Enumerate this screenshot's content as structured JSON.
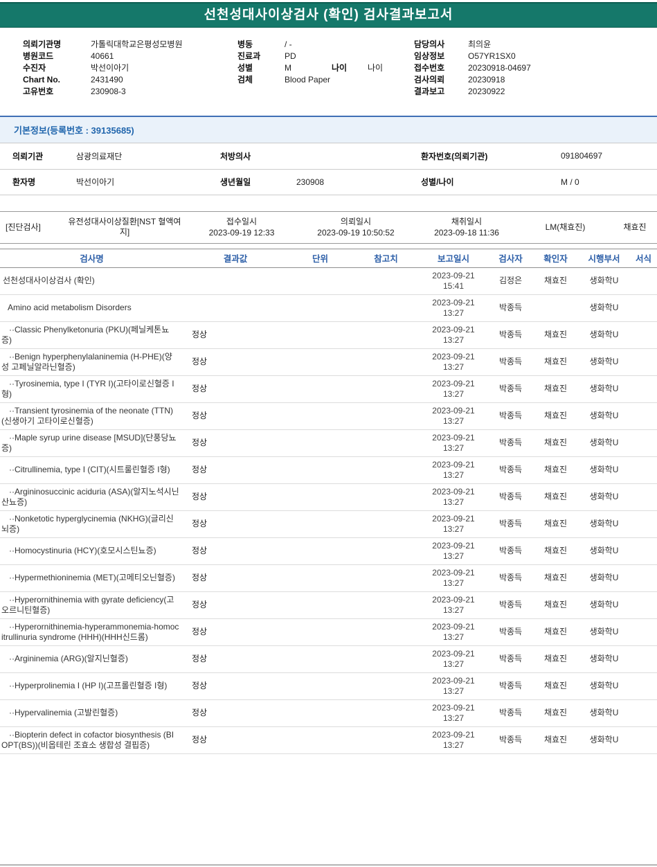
{
  "page": {
    "title": "선천성대사이상검사 (확인) 검사결과보고서"
  },
  "header": {
    "left": [
      {
        "label": "의뢰기관명",
        "value": "가톨릭대학교은평성모병원"
      },
      {
        "label": "병원코드",
        "value": "40661"
      },
      {
        "label": "수진자",
        "value": "박선이아기"
      },
      {
        "label": "Chart No.",
        "value": "2431490"
      },
      {
        "label": "고유번호",
        "value": "230908-3"
      }
    ],
    "middle": [
      {
        "label": "병동",
        "value": "/ -"
      },
      {
        "label": "진료과",
        "value": "PD"
      },
      {
        "label": "성별",
        "value": "M"
      },
      {
        "label": "검체",
        "value": "Blood Paper"
      }
    ],
    "age": {
      "label": "나이",
      "value": "나이"
    },
    "right": [
      {
        "label": "담당의사",
        "value": "최의윤"
      },
      {
        "label": "임상정보",
        "value": "O57YR1SX0"
      },
      {
        "label": "접수번호",
        "value": "20230918-04697"
      },
      {
        "label": "검사의뢰",
        "value": "20230918"
      },
      {
        "label": "결과보고",
        "value": "20230922"
      }
    ]
  },
  "basic_info": {
    "title": "기본정보(등록번호 : 39135685)",
    "rows": [
      {
        "cells": [
          {
            "label": "의뢰기관",
            "value": "삼광의료재단"
          },
          {
            "label": "처방의사",
            "value": ""
          },
          {
            "label": "환자번호(의뢰기관)",
            "value": "091804697"
          }
        ]
      },
      {
        "cells": [
          {
            "label": "환자명",
            "value": "박선이아기"
          },
          {
            "label": "생년월일",
            "value": "230908"
          },
          {
            "label": "성별/나이",
            "value": "M / 0"
          }
        ]
      }
    ]
  },
  "diagnosis": {
    "section_label": "[진단검사]",
    "test_name": "유전성대사이상질환[NST 혈액여지]",
    "receipt_label": "접수일시",
    "receipt_value": "2023-09-19 12:33",
    "request_label": "의뢰일시",
    "request_value": "2023-09-19 10:50:52",
    "collection_label": "채취일시",
    "collection_value": "2023-09-18 11:36",
    "collector": "LM(채효진)",
    "collector2": "채효진"
  },
  "results": {
    "columns": [
      "검사명",
      "결과값",
      "단위",
      "참고치",
      "보고일시",
      "검사자",
      "확인자",
      "시행부서",
      "서식"
    ],
    "rows": [
      {
        "indent": 0,
        "name": "선천성대사이상검사 (확인)",
        "result": "",
        "unit": "",
        "ref": "",
        "date": "2023-09-21",
        "time": "15:41",
        "tester": "김정은",
        "confirmer": "채효진",
        "dept": "생화학U",
        "format": ""
      },
      {
        "indent": 1,
        "name": "Amino acid metabolism Disorders",
        "result": "",
        "unit": "",
        "ref": "",
        "date": "2023-09-21",
        "time": "13:27",
        "tester": "박종득",
        "confirmer": "",
        "dept": "생화학U",
        "format": ""
      },
      {
        "indent": 2,
        "name": "··Classic Phenylketonuria (PKU)(페닐케톤뇨증)",
        "result": "정상",
        "unit": "",
        "ref": "",
        "date": "2023-09-21",
        "time": "13:27",
        "tester": "박종득",
        "confirmer": "채효진",
        "dept": "생화학U",
        "format": ""
      },
      {
        "indent": 2,
        "name": "··Benign hyperphenylalaninemia (H-PHE)(양성 고페닐알라닌혈증)",
        "result": "정상",
        "unit": "",
        "ref": "",
        "date": "2023-09-21",
        "time": "13:27",
        "tester": "박종득",
        "confirmer": "채효진",
        "dept": "생화학U",
        "format": ""
      },
      {
        "indent": 2,
        "name": "··Tyrosinemia, type I (TYR I)(고타이로신혈증 I형)",
        "result": "정상",
        "unit": "",
        "ref": "",
        "date": "2023-09-21",
        "time": "13:27",
        "tester": "박종득",
        "confirmer": "채효진",
        "dept": "생화학U",
        "format": ""
      },
      {
        "indent": 2,
        "name": "··Transient tyrosinemia of the neonate (TTN)(신생아기 고타이로신혈증)",
        "result": "정상",
        "unit": "",
        "ref": "",
        "date": "2023-09-21",
        "time": "13:27",
        "tester": "박종득",
        "confirmer": "채효진",
        "dept": "생화학U",
        "format": ""
      },
      {
        "indent": 2,
        "name": "··Maple syrup urine disease [MSUD](단풍당뇨증)",
        "result": "정상",
        "unit": "",
        "ref": "",
        "date": "2023-09-21",
        "time": "13:27",
        "tester": "박종득",
        "confirmer": "채효진",
        "dept": "생화학U",
        "format": ""
      },
      {
        "indent": 2,
        "name": "··Citrullinemia, type I (CIT)(시트룰린혈증 I형)",
        "result": "정상",
        "unit": "",
        "ref": "",
        "date": "2023-09-21",
        "time": "13:27",
        "tester": "박종득",
        "confirmer": "채효진",
        "dept": "생화학U",
        "format": ""
      },
      {
        "indent": 2,
        "name": "··Argininosuccinic aciduria (ASA)(알지노석시닌산뇨증)",
        "result": "정상",
        "unit": "",
        "ref": "",
        "date": "2023-09-21",
        "time": "13:27",
        "tester": "박종득",
        "confirmer": "채효진",
        "dept": "생화학U",
        "format": ""
      },
      {
        "indent": 2,
        "name": "··Nonketotic hyperglycinemia (NKHG)(글리신뇌증)",
        "result": "정상",
        "unit": "",
        "ref": "",
        "date": "2023-09-21",
        "time": "13:27",
        "tester": "박종득",
        "confirmer": "채효진",
        "dept": "생화학U",
        "format": ""
      },
      {
        "indent": 2,
        "name": "··Homocystinuria (HCY)(호모시스틴뇨증)",
        "result": "정상",
        "unit": "",
        "ref": "",
        "date": "2023-09-21",
        "time": "13:27",
        "tester": "박종득",
        "confirmer": "채효진",
        "dept": "생화학U",
        "format": ""
      },
      {
        "indent": 2,
        "name": "··Hypermethioninemia (MET)(고메티오닌혈증)",
        "result": "정상",
        "unit": "",
        "ref": "",
        "date": "2023-09-21",
        "time": "13:27",
        "tester": "박종득",
        "confirmer": "채효진",
        "dept": "생화학U",
        "format": ""
      },
      {
        "indent": 2,
        "name": "··Hyperornithinemia with gyrate deficiency(고오르니틴혈증)",
        "result": "정상",
        "unit": "",
        "ref": "",
        "date": "2023-09-21",
        "time": "13:27",
        "tester": "박종득",
        "confirmer": "채효진",
        "dept": "생화학U",
        "format": ""
      },
      {
        "indent": 2,
        "name": "··Hyperornithinemia-hyperammonemia-homocitrullinuria syndrome (HHH)(HHH신드롬)",
        "result": "정상",
        "unit": "",
        "ref": "",
        "date": "2023-09-21",
        "time": "13:27",
        "tester": "박종득",
        "confirmer": "채효진",
        "dept": "생화학U",
        "format": ""
      },
      {
        "indent": 2,
        "name": "··Argininemia (ARG)(알지닌혈증)",
        "result": "정상",
        "unit": "",
        "ref": "",
        "date": "2023-09-21",
        "time": "13:27",
        "tester": "박종득",
        "confirmer": "채효진",
        "dept": "생화학U",
        "format": ""
      },
      {
        "indent": 2,
        "name": "··Hyperprolinemia I (HP I)(고프롤린혈증 I형)",
        "result": "정상",
        "unit": "",
        "ref": "",
        "date": "2023-09-21",
        "time": "13:27",
        "tester": "박종득",
        "confirmer": "채효진",
        "dept": "생화학U",
        "format": ""
      },
      {
        "indent": 2,
        "name": "··Hypervalinemia (고발린혈증)",
        "result": "정상",
        "unit": "",
        "ref": "",
        "date": "2023-09-21",
        "time": "13:27",
        "tester": "박종득",
        "confirmer": "채효진",
        "dept": "생화학U",
        "format": ""
      },
      {
        "indent": 2,
        "name": "··Biopterin defect in cofactor biosynthesis (BIOPT(BS))(비옵테린 조효소 생합성 결핍증)",
        "result": "정상",
        "unit": "",
        "ref": "",
        "date": "2023-09-21",
        "time": "13:27",
        "tester": "박종득",
        "confirmer": "채효진",
        "dept": "생화학U",
        "format": ""
      }
    ]
  }
}
